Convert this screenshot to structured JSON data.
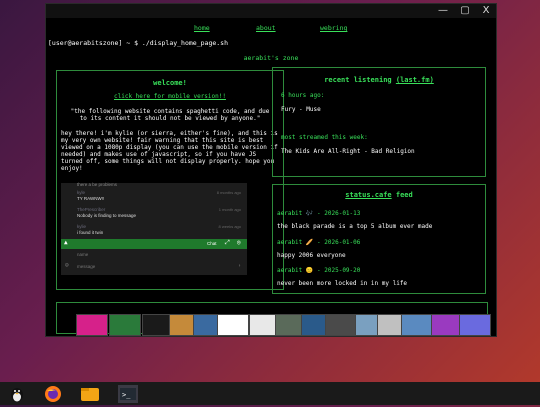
{
  "window": {
    "minimize": "—",
    "maximize": "▢",
    "close": "X"
  },
  "nav": {
    "home": "home",
    "about": "about",
    "webring": "webring"
  },
  "terminal": {
    "command": "[user@aerabitszone] ~ $ ./display_home_page.sh"
  },
  "site": {
    "title": "aerabit's zone"
  },
  "welcome": {
    "heading": "welcome!",
    "mobile_link": "click here for mobile version!!",
    "warning": "\"the following website contains spaghetti code, and due to its content it should not be viewed by anyone.\"",
    "intro": "hey there! i'm kylie (or sierra, either's fine), and this is my very own website! fair warning that this site is best viewed on a 1080p display (you can use the mobile version if needed) and makes use of javascript, so if you have JS turned off, some things will not display properly. hope you enjoy!"
  },
  "chat": {
    "top_cut": "there a be problems",
    "messages": [
      {
        "name": "kyle",
        "message": "TY RAWNW!!",
        "time": "8 months ago"
      },
      {
        "name": "ThePrescriber",
        "message": "Nobody is finding to message",
        "time": "1 month ago"
      },
      {
        "name": "kylie",
        "message": "i found it twin",
        "time": "8 weeks ago"
      }
    ],
    "bar_label": "Chat",
    "name_placeholder": "name",
    "message_placeholder": "message"
  },
  "recent_listening": {
    "heading_prefix": "recent listening",
    "heading_link": "(last.fm)",
    "time_ago": "6 hours ago:",
    "track": "Fury - Muse",
    "most_streamed_label": "most streamed this week:",
    "most_streamed": "The Kids Are All-Right - Bad Religion"
  },
  "status": {
    "heading_link": "status.cafe",
    "heading_suffix": " feed",
    "entries": [
      {
        "user": "aerabit",
        "emoji": "🎶",
        "date": "- 2026-01-13",
        "text": "the black parade is a top 5 album ever made"
      },
      {
        "user": "aerabit",
        "emoji": "🥖",
        "date": "- 2026-01-06",
        "text": "happy 2006 everyone"
      },
      {
        "user": "aerabit",
        "emoji": "😑",
        "date": "- 2025-09-20",
        "text": "never been more locked in in my life"
      }
    ]
  },
  "badges": {
    "colors": [
      "#d6218a",
      "#2a7a3a",
      "#1a1a1a",
      "#c58a3a",
      "#3a6aa0",
      "#ffffff",
      "#e8e8e8",
      "#5a6a5a",
      "#2a5a8a",
      "#4a4a4a",
      "#7aa0c0",
      "#c0c0c0",
      "#5a8ac0",
      "#9a3ac0",
      "#6a6adf"
    ]
  },
  "taskbar": {
    "icons": [
      "linux-icon",
      "firefox-icon",
      "files-icon",
      "terminal-icon"
    ]
  }
}
